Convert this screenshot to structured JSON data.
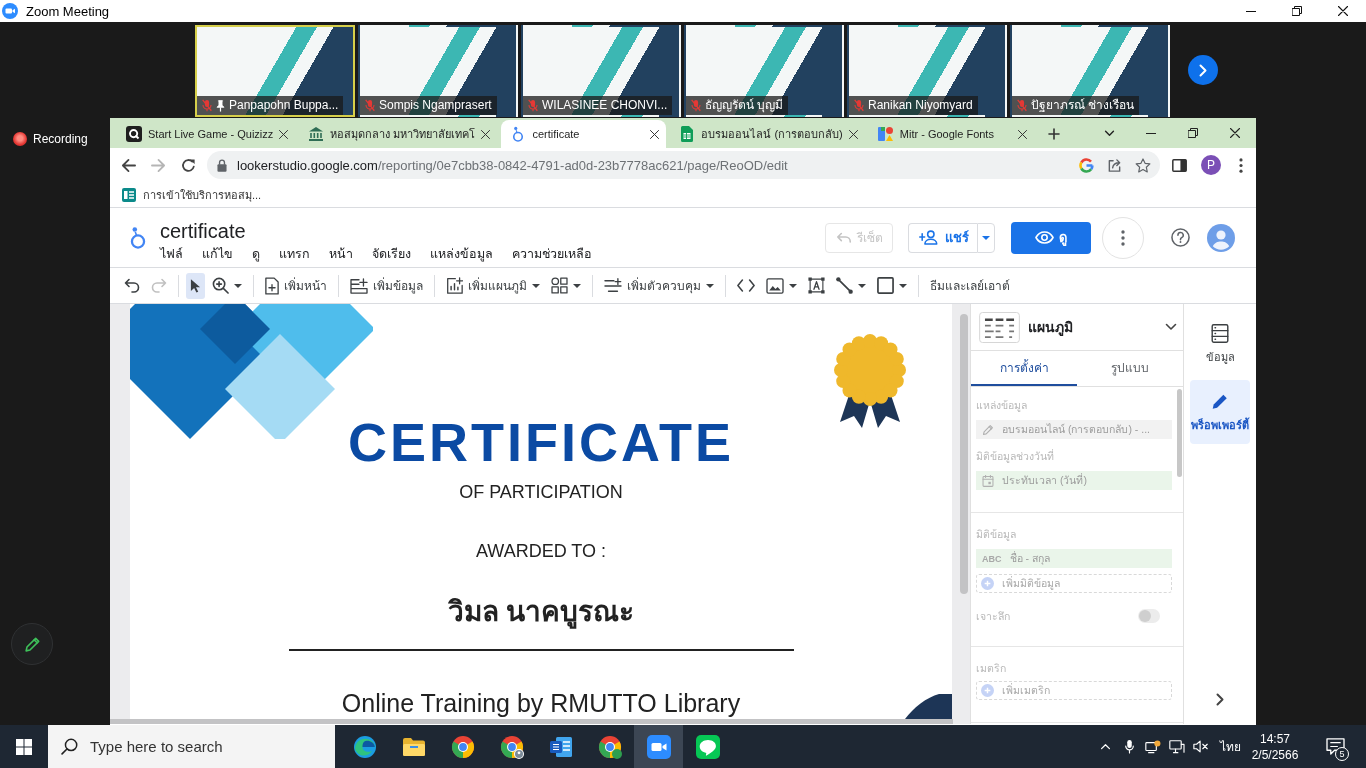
{
  "zoom_window": {
    "title": "Zoom Meeting"
  },
  "participants": [
    {
      "name": "Panpapohn Buppa...",
      "muted": true,
      "pinned": true,
      "speaking": true
    },
    {
      "name": "Sompis Ngamprasert",
      "muted": true,
      "pinned": false,
      "speaking": false
    },
    {
      "name": "WILASINEE CHONVI...",
      "muted": true,
      "pinned": false,
      "speaking": false
    },
    {
      "name": "ธัญญรัตน์ บุญมี",
      "muted": true,
      "pinned": false,
      "speaking": false
    },
    {
      "name": "Ranikan Niyomyard",
      "muted": true,
      "pinned": false,
      "speaking": false
    },
    {
      "name": "ปัฐยาภรณ์ ช่างเรือน",
      "muted": true,
      "pinned": false,
      "speaking": false
    }
  ],
  "recording": {
    "label": "Recording"
  },
  "browser": {
    "tabs": [
      {
        "kind": "quiz",
        "title": "Start Live Game - Quizizz",
        "selected": false
      },
      {
        "kind": "library",
        "title": "หอสมุดกลาง มหาวิทยาลัยเทคโ",
        "selected": false
      },
      {
        "kind": "report",
        "title": "certificate",
        "selected": true
      },
      {
        "kind": "sheet",
        "title": "อบรมออนไลน์ (การตอบกลับ)",
        "selected": false
      },
      {
        "kind": "fonts",
        "title": "Mitr - Google Fonts",
        "selected": false
      }
    ],
    "address": {
      "host": "lookerstudio.google.com",
      "path": "/reporting/0e7cbb38-0842-4791-ad0d-23b7778ac621/page/ReoOD/edit"
    },
    "profile_initial": "P",
    "bookmarks": [
      {
        "title": "การเข้าใช้บริการหอสมุ..."
      }
    ]
  },
  "report": {
    "title": "certificate",
    "menu": [
      "ไฟล์",
      "แก้ไข",
      "ดู",
      "แทรก",
      "หน้า",
      "จัดเรียง",
      "แหล่งข้อมูล",
      "ความช่วยเหลือ"
    ],
    "reset": {
      "label": "รีเซ็ต",
      "disabled": true
    },
    "share": {
      "label": "แชร์"
    },
    "view": {
      "label": "ดู"
    },
    "toolbar": [
      [
        {
          "kind": "undo",
          "dropdown": false,
          "disabled": false,
          "selected": false
        },
        {
          "kind": "redo",
          "dropdown": false,
          "disabled": true,
          "selected": false
        }
      ],
      [
        {
          "kind": "select",
          "dropdown": false,
          "disabled": false,
          "selected": true
        },
        {
          "kind": "zoom",
          "dropdown": true,
          "disabled": false,
          "selected": false
        }
      ],
      [
        {
          "kind": "add_page",
          "label": "เพิ่มหน้า",
          "dropdown": false,
          "disabled": false,
          "selected": false
        }
      ],
      [
        {
          "kind": "add_data",
          "label": "เพิ่มข้อมูล",
          "dropdown": false,
          "disabled": false,
          "selected": false
        }
      ],
      [
        {
          "kind": "add_chart",
          "label": "เพิ่มแผนภูมิ",
          "dropdown": true,
          "disabled": false,
          "selected": false
        },
        {
          "kind": "components",
          "dropdown": true,
          "disabled": false,
          "selected": false
        }
      ],
      [
        {
          "kind": "add_control",
          "label": "เพิ่มตัวควบคุม",
          "dropdown": true,
          "disabled": false,
          "selected": false
        }
      ],
      [
        {
          "kind": "code",
          "dropdown": false,
          "disabled": false,
          "selected": false
        },
        {
          "kind": "image",
          "dropdown": true,
          "disabled": false,
          "selected": false
        },
        {
          "kind": "text",
          "dropdown": false,
          "disabled": false,
          "selected": false
        },
        {
          "kind": "line",
          "dropdown": true,
          "disabled": false,
          "selected": false
        },
        {
          "kind": "shape",
          "dropdown": true,
          "disabled": false,
          "selected": false
        }
      ],
      [
        {
          "kind": "theme",
          "label": "ธีมและเลย์เอาต์",
          "dropdown": false,
          "disabled": false,
          "selected": false
        }
      ]
    ]
  },
  "certificate": {
    "title": "CERTIFICATE",
    "subtitle": "OF PARTICIPATION",
    "awarded_label": "AWARDED TO :",
    "recipient": "วิมล นาคบูรณะ",
    "course": "Online Training by RMUTTO Library"
  },
  "properties": {
    "component": "แผนภูมิ",
    "tabs": [
      {
        "label": "การตั้งค่า",
        "selected": true
      },
      {
        "label": "รูปแบบ",
        "selected": false
      }
    ],
    "sections": [
      {
        "items": [
          {
            "kind": "label",
            "text": "แหล่งข้อมูล"
          },
          {
            "kind": "source",
            "text": "อบรมออนไลน์ (การตอบกลับ) - ..."
          },
          {
            "kind": "label",
            "text": "มิติข้อมูลช่วงวันที่"
          },
          {
            "kind": "date",
            "text": "ประทับเวลา (วันที่)"
          }
        ]
      },
      {
        "items": [
          {
            "kind": "label",
            "text": "มิติข้อมูล"
          },
          {
            "kind": "dimension",
            "type": "ABC",
            "text": "ชื่อ - สกุล"
          },
          {
            "kind": "add",
            "text": "เพิ่มมิติข้อมูล"
          },
          {
            "kind": "toggle",
            "label": "เจาะลึก",
            "on": false
          }
        ]
      },
      {
        "items": [
          {
            "kind": "label",
            "text": "เมตริก"
          },
          {
            "kind": "add",
            "text": "เพิ่มเมตริก"
          }
        ]
      }
    ]
  },
  "side_rail": [
    {
      "kind": "data",
      "label": "ข้อมูล",
      "selected": false
    },
    {
      "kind": "properties",
      "label": "พร็อพเพอร์ตี้",
      "selected": true
    }
  ],
  "taskbar": {
    "search_placeholder": "Type here to search",
    "apps": [
      {
        "kind": "browser_swirl",
        "active": false
      },
      {
        "kind": "folder",
        "active": false
      },
      {
        "kind": "browser",
        "active": false
      },
      {
        "kind": "browser_profile",
        "active": false
      },
      {
        "kind": "document",
        "active": false
      },
      {
        "kind": "browser_badge",
        "active": false
      },
      {
        "kind": "video_call",
        "active": true
      },
      {
        "kind": "chat",
        "active": false
      }
    ],
    "language": "ไทย",
    "time": "14:57",
    "date": "2/5/2566",
    "notification_count": "5"
  }
}
